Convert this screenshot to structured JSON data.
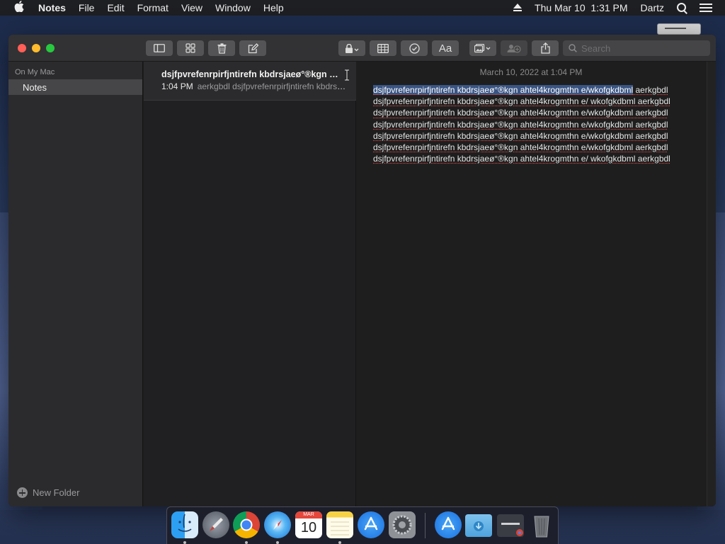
{
  "menubar": {
    "apple_icon": "apple-logo-icon",
    "app": "Notes",
    "items": [
      "File",
      "Edit",
      "Format",
      "View",
      "Window",
      "Help"
    ],
    "datetime": "Thu Mar 10  1:31 PM",
    "user": "Dartz"
  },
  "toolbar": {
    "search_placeholder": "Search",
    "format_label": "Aa",
    "icons": [
      "sidebar-toggle-icon",
      "gallery-icon",
      "trash-icon",
      "compose-icon",
      "lock-icon",
      "table-icon",
      "checklist-icon",
      "format-icon",
      "media-icon",
      "collaborate-icon",
      "share-icon",
      "search-icon"
    ]
  },
  "sidebar": {
    "section": "On My Mac",
    "folder": "Notes",
    "new_folder": "New Folder"
  },
  "note_list": {
    "items": [
      {
        "title": "dsjfpvrefenrpirfjntirefn kbdrsjaeø°®kgn ahtel4krogmthn e/wkofgkdbml",
        "time": "1:04 PM",
        "preview": "aerkgbdl dsjfpvrefenrpirfjntirefn kbdrsjaeø°®kgn"
      }
    ]
  },
  "editor": {
    "date": "March 10, 2022 at 1:04 PM",
    "selected_text": "dsjfpvrefenrpirfjntirefn kbdrsjaeø°®kgn ahtel4krogmthn e/wkofgkdbml",
    "body_text": " aerkgbdl dsjfpvrefenrpirfjntirefn kbdrsjaeø°®kgn ahtel4krogmthn e/ wkofgkdbml aerkgbdl dsjfpvrefenrpirfjntirefn kbdrsjaeø°®kgn ahtel4krogmthn e/wkofgkdbml aerkgbdl dsjfpvrefenrpirfjntirefn kbdrsjaeø°®kgn ahtel4krogmthn e/wkofgkdbml aerkgbdl dsjfpvrefenrpirfjntirefn kbdrsjaeø°®kgn ahtel4krogmthn e/wkofgkdbml aerkgbdl dsjfpvrefenrpirfjntirefn kbdrsjaeø°®kgn ahtel4krogmthn e/wkofgkdbml aerkgbdl dsjfpvrefenrpirfjntirefn kbdrsjaeø°®kgn ahtel4krogmthn e/ wkofgkdbml aerkgbdl"
  },
  "dock": {
    "calendar_month": "MAR",
    "calendar_day": "10",
    "apps": [
      "finder-icon",
      "launchpad-icon",
      "chrome-icon",
      "safari-icon",
      "calendar-icon",
      "notes-icon",
      "app-store-icon",
      "system-preferences-icon",
      "app-store-downloads-icon",
      "downloads-folder-icon",
      "chrome-app-icon",
      "trash-icon"
    ]
  }
}
